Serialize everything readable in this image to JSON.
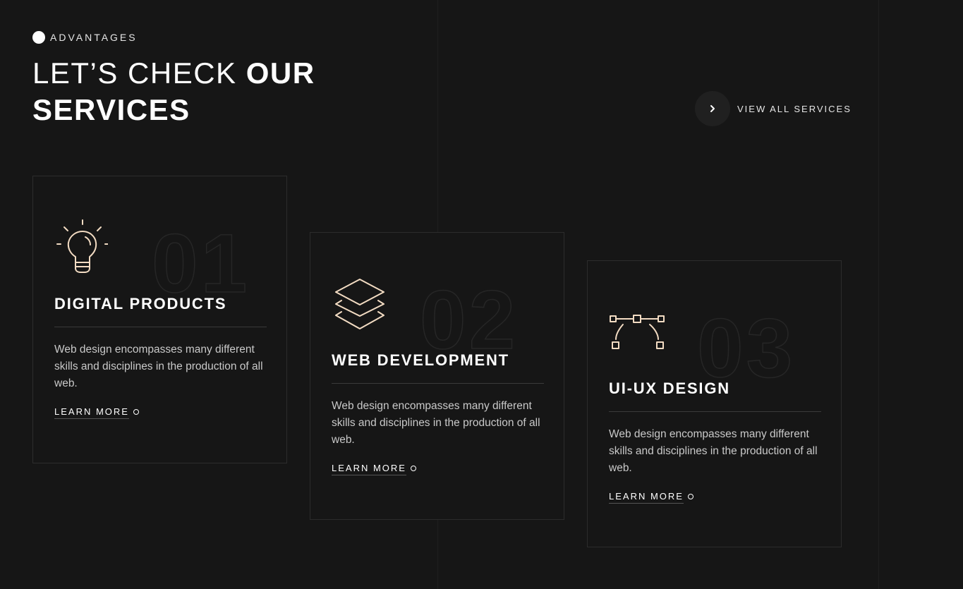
{
  "section": {
    "eyebrow": "ADVANTAGES",
    "heading_light": "LET’S CHECK ",
    "heading_bold_1": "OUR",
    "heading_bold_2": "SERVICES",
    "view_all_label": "VIEW ALL SERVICES"
  },
  "colors": {
    "background": "#161616",
    "icon_accent": "#f3dcc3",
    "card_border": "#2c2c2c"
  },
  "cards": [
    {
      "number": "01",
      "icon": "lightbulb-icon",
      "title": "DIGITAL PRODUCTS",
      "description": "Web design encompasses many different skills and disciplines in the production of all web.",
      "link_label": "LEARN MORE"
    },
    {
      "number": "02",
      "icon": "layers-icon",
      "title": "WEB DEVELOPMENT",
      "description": "Web design encompasses many different skills and disciplines in the production of all web.",
      "link_label": "LEARN MORE"
    },
    {
      "number": "03",
      "icon": "vector-path-icon",
      "title": "UI-UX DESIGN",
      "description": "Web design encompasses many different skills and disciplines in the production of all web.",
      "link_label": "LEARN MORE"
    }
  ]
}
